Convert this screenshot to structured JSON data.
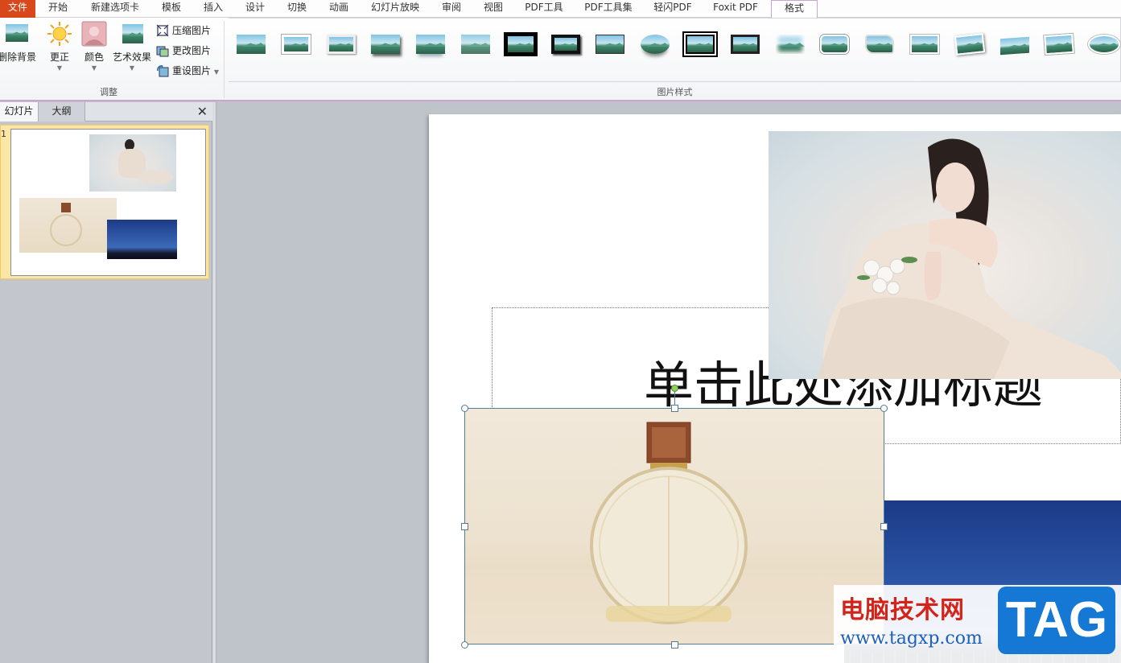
{
  "tabs": [
    "文件",
    "开始",
    "新建选项卡",
    "模板",
    "插入",
    "设计",
    "切换",
    "动画",
    "幻灯片放映",
    "审阅",
    "视图",
    "PDF工具",
    "PDF工具集",
    "轻闪PDF",
    "Foxit PDF",
    "格式"
  ],
  "ribbon": {
    "adjust": {
      "remove_bg": "删除背景",
      "corrections": "更正",
      "color": "颜色",
      "artistic": "艺术效果",
      "compress": "压缩图片",
      "change": "更改图片",
      "reset": "重设图片",
      "group_label": "调整"
    },
    "styles": {
      "group_label": "图片样式",
      "count": 20
    }
  },
  "panel": {
    "tab_slides": "幻灯片",
    "tab_outline": "大纲",
    "close": "✕",
    "slide_number": "1"
  },
  "slide": {
    "title_placeholder": "单击此处添加标题"
  },
  "watermark": {
    "title": "电脑技术网",
    "url": "www.tagxp.com",
    "tag": "TAG"
  },
  "colors": {
    "file_tab": "#d9481b",
    "format_border": "#c9a6cf",
    "selection_handle": "#5a7891",
    "rotation_handle": "#8fd160"
  }
}
